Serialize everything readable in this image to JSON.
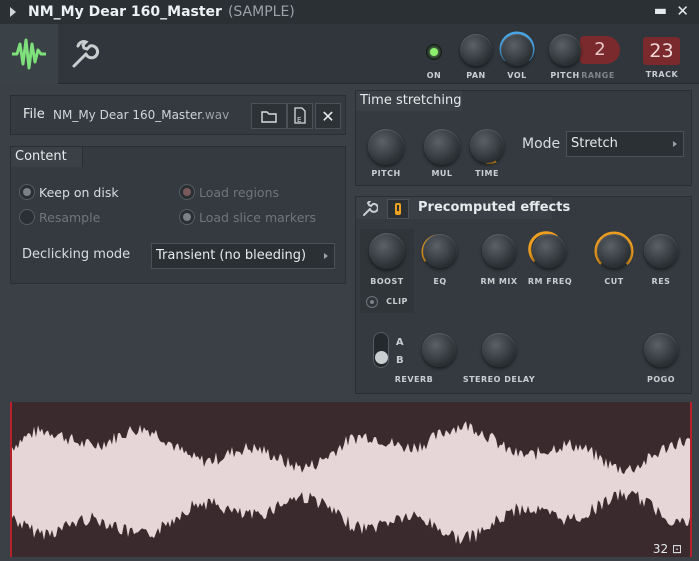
{
  "window": {
    "title": "NM_My Dear 160_Master",
    "subtitle": "(SAMPLE)",
    "minimize": "▬",
    "close": "✕"
  },
  "toolbar": {
    "on_label": "ON",
    "pan_label": "PAN",
    "vol_label": "VOL",
    "pitch_label": "PITCH",
    "range_label": "RANGE",
    "range_value": "2",
    "track_label": "TRACK",
    "track_value": "23"
  },
  "file": {
    "label": "File",
    "name": "NM_My Dear 160_Master",
    "ext": ".wav"
  },
  "content": {
    "title": "Content",
    "keep_on_disk": "Keep on disk",
    "resample": "Resample",
    "load_regions": "Load regions",
    "load_slice_markers": "Load slice markers",
    "declick_label": "Declicking mode",
    "declick_value": "Transient (no bleeding)"
  },
  "time_stretching": {
    "title": "Time stretching",
    "pitch": "PITCH",
    "mul": "MUL",
    "time": "TIME",
    "mode_label": "Mode",
    "mode_value": "Stretch"
  },
  "precomputed": {
    "title": "Precomputed effects",
    "boost": "BOOST",
    "eq": "EQ",
    "rm_mix": "RM MIX",
    "rm_freq": "RM FREQ",
    "cut": "CUT",
    "res": "RES",
    "clip": "CLIP",
    "a": "A",
    "b": "B",
    "reverb": "REVERB",
    "stereo_delay": "STEREO DELAY",
    "pogo": "POGO"
  },
  "waveform": {
    "zoom": "32"
  },
  "colors": {
    "accent_orange": "#f0a020",
    "accent_blue": "#4aa8e8",
    "wave_color": "#e6d6d8",
    "led_green": "#8cf06e"
  }
}
